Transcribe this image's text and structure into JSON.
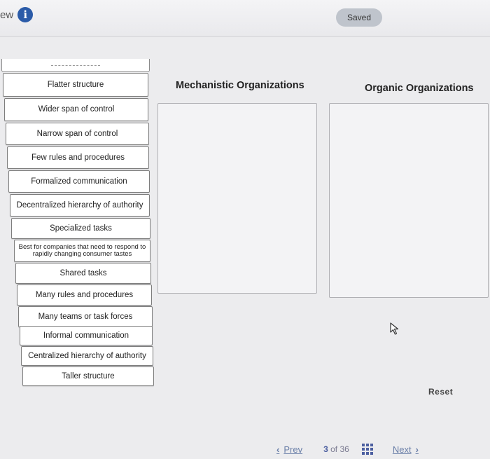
{
  "header": {
    "left_fragment": "ew",
    "info_icon": "info-icon",
    "saved_label": "Saved"
  },
  "bank": {
    "items": [
      "Flatter structure",
      "Wider span of control",
      "Narrow span of control",
      "Few rules and procedures",
      "Formalized communication",
      "Decentralized hierarchy of authority",
      "Specialized tasks",
      "Best for companies that need to respond to rapidly changing consumer tastes",
      "Shared tasks",
      "Many rules and procedures",
      "Many teams or task forces",
      "Informal communication",
      "Centralized hierarchy of authority",
      "Taller structure"
    ]
  },
  "columns": {
    "mechanistic": "Mechanistic Organizations",
    "organic": "Organic Organizations"
  },
  "actions": {
    "reset": "Reset"
  },
  "pager": {
    "prev": "Prev",
    "current": "3",
    "of": "of",
    "total": "36",
    "next": "Next",
    "grid_icon": "grid-icon"
  },
  "colors": {
    "info": "#2b5ba8",
    "link": "#6a7fa8",
    "saved_bg": "#bfc4cc"
  }
}
